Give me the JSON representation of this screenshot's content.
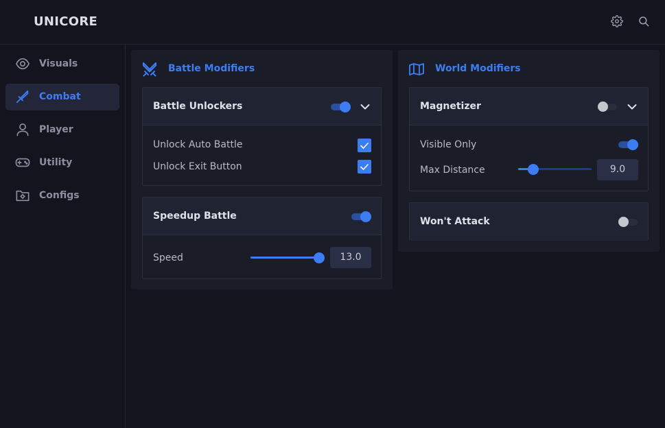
{
  "app": {
    "title": "UNICORE"
  },
  "topbar": {
    "icons": [
      "gear-icon",
      "search-icon"
    ]
  },
  "sidebar": {
    "items": [
      {
        "label": "Visuals",
        "icon": "eye-icon",
        "active": false
      },
      {
        "label": "Combat",
        "icon": "sword-icon",
        "active": true
      },
      {
        "label": "Player",
        "icon": "user-icon",
        "active": false
      },
      {
        "label": "Utility",
        "icon": "gamepad-icon",
        "active": false
      },
      {
        "label": "Configs",
        "icon": "folder-gear-icon",
        "active": false
      }
    ]
  },
  "battle": {
    "title": "Battle Modifiers",
    "icon": "crossed-swords-icon",
    "unlockers": {
      "title": "Battle Unlockers",
      "enabled": true,
      "options": [
        {
          "label": "Unlock Auto Battle",
          "checked": true
        },
        {
          "label": "Unlock Exit Button",
          "checked": true
        }
      ]
    },
    "speedup": {
      "title": "Speedup Battle",
      "enabled": true,
      "speed_label": "Speed",
      "speed_value": "13.0",
      "speed_fraction": 1.0
    }
  },
  "world": {
    "title": "World Modifiers",
    "icon": "map-icon",
    "magnetizer": {
      "title": "Magnetizer",
      "enabled": false,
      "visible_only_label": "Visible Only",
      "visible_only": true,
      "max_distance_label": "Max Distance",
      "max_distance_value": "9.0",
      "max_distance_fraction": 0.21
    },
    "wont_attack": {
      "title": "Won't Attack",
      "enabled": false
    }
  },
  "colors": {
    "accent": "#3d7df2",
    "background": "#13141d",
    "panel": "#1a1c27",
    "card_header": "#202331"
  }
}
